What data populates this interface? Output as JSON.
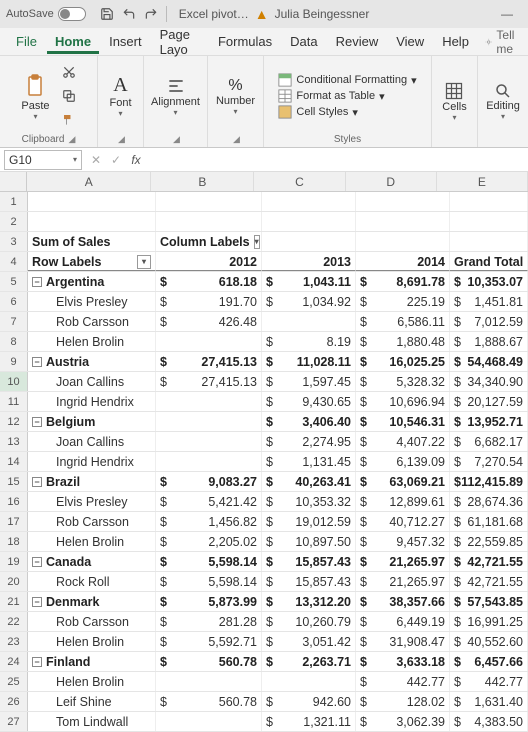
{
  "titlebar": {
    "autosave": "AutoSave",
    "filename": "Excel pivot…",
    "username": "Julia Beingessner"
  },
  "tabs": {
    "file": "File",
    "home": "Home",
    "insert": "Insert",
    "pagelayout": "Page Layo",
    "formulas": "Formulas",
    "data": "Data",
    "review": "Review",
    "view": "View",
    "help": "Help",
    "tellme": "Tell me"
  },
  "ribbon": {
    "clipboard": "Clipboard",
    "paste": "Paste",
    "font": "Font",
    "alignment": "Alignment",
    "number": "Number",
    "styles": "Styles",
    "condfmt": "Conditional Formatting",
    "fmttable": "Format as Table",
    "cellstyles": "Cell Styles",
    "cells": "Cells",
    "editing": "Editing"
  },
  "namebox": "G10",
  "columns": [
    "A",
    "B",
    "C",
    "D",
    "E"
  ],
  "pivot": {
    "title": "Sum of Sales",
    "colLabels": "Column Labels",
    "rowLabels": "Row Labels",
    "years": [
      "2012",
      "2013",
      "2014"
    ],
    "grandTotal": "Grand Total"
  },
  "rows": [
    {
      "n": 1,
      "type": "blank"
    },
    {
      "n": 2,
      "type": "blank"
    },
    {
      "n": 3,
      "type": "h1"
    },
    {
      "n": 4,
      "type": "h2"
    },
    {
      "n": 5,
      "type": "country",
      "label": "Argentina",
      "v": [
        "618.18",
        "1,043.11",
        "8,691.78",
        "10,353.07"
      ]
    },
    {
      "n": 6,
      "type": "person",
      "label": "Elvis Presley",
      "v": [
        "191.70",
        "1,034.92",
        "225.19",
        "1,451.81"
      ]
    },
    {
      "n": 7,
      "type": "person",
      "label": "Rob Carsson",
      "v": [
        "426.48",
        "",
        "6,586.11",
        "7,012.59"
      ]
    },
    {
      "n": 8,
      "type": "person",
      "label": "Helen Brolin",
      "v": [
        "",
        "8.19",
        "1,880.48",
        "1,888.67"
      ]
    },
    {
      "n": 9,
      "type": "country",
      "label": "Austria",
      "v": [
        "27,415.13",
        "11,028.11",
        "16,025.25",
        "54,468.49"
      ]
    },
    {
      "n": 10,
      "type": "person",
      "label": "Joan Callins",
      "v": [
        "27,415.13",
        "1,597.45",
        "5,328.32",
        "34,340.90"
      ],
      "sel": true
    },
    {
      "n": 11,
      "type": "person",
      "label": "Ingrid Hendrix",
      "v": [
        "",
        "9,430.65",
        "10,696.94",
        "20,127.59"
      ]
    },
    {
      "n": 12,
      "type": "country",
      "label": "Belgium",
      "v": [
        "",
        "3,406.40",
        "10,546.31",
        "13,952.71"
      ]
    },
    {
      "n": 13,
      "type": "person",
      "label": "Joan Callins",
      "v": [
        "",
        "2,274.95",
        "4,407.22",
        "6,682.17"
      ]
    },
    {
      "n": 14,
      "type": "person",
      "label": "Ingrid Hendrix",
      "v": [
        "",
        "1,131.45",
        "6,139.09",
        "7,270.54"
      ]
    },
    {
      "n": 15,
      "type": "country",
      "label": "Brazil",
      "v": [
        "9,083.27",
        "40,263.41",
        "63,069.21",
        "112,415.89"
      ]
    },
    {
      "n": 16,
      "type": "person",
      "label": "Elvis Presley",
      "v": [
        "5,421.42",
        "10,353.32",
        "12,899.61",
        "28,674.36"
      ]
    },
    {
      "n": 17,
      "type": "person",
      "label": "Rob Carsson",
      "v": [
        "1,456.82",
        "19,012.59",
        "40,712.27",
        "61,181.68"
      ]
    },
    {
      "n": 18,
      "type": "person",
      "label": "Helen Brolin",
      "v": [
        "2,205.02",
        "10,897.50",
        "9,457.32",
        "22,559.85"
      ]
    },
    {
      "n": 19,
      "type": "country",
      "label": "Canada",
      "v": [
        "5,598.14",
        "15,857.43",
        "21,265.97",
        "42,721.55"
      ]
    },
    {
      "n": 20,
      "type": "person",
      "label": "Rock Roll",
      "v": [
        "5,598.14",
        "15,857.43",
        "21,265.97",
        "42,721.55"
      ]
    },
    {
      "n": 21,
      "type": "country",
      "label": "Denmark",
      "v": [
        "5,873.99",
        "13,312.20",
        "38,357.66",
        "57,543.85"
      ]
    },
    {
      "n": 22,
      "type": "person",
      "label": "Rob Carsson",
      "v": [
        "281.28",
        "10,260.79",
        "6,449.19",
        "16,991.25"
      ]
    },
    {
      "n": 23,
      "type": "person",
      "label": "Helen Brolin",
      "v": [
        "5,592.71",
        "3,051.42",
        "31,908.47",
        "40,552.60"
      ]
    },
    {
      "n": 24,
      "type": "country",
      "label": "Finland",
      "v": [
        "560.78",
        "2,263.71",
        "3,633.18",
        "6,457.66"
      ]
    },
    {
      "n": 25,
      "type": "person",
      "label": "Helen Brolin",
      "v": [
        "",
        "",
        "442.77",
        "442.77"
      ]
    },
    {
      "n": 26,
      "type": "person",
      "label": "Leif Shine",
      "v": [
        "560.78",
        "942.60",
        "128.02",
        "1,631.40"
      ]
    },
    {
      "n": 27,
      "type": "person",
      "label": "Tom Lindwall",
      "v": [
        "",
        "1,321.11",
        "3,062.39",
        "4,383.50"
      ]
    }
  ]
}
